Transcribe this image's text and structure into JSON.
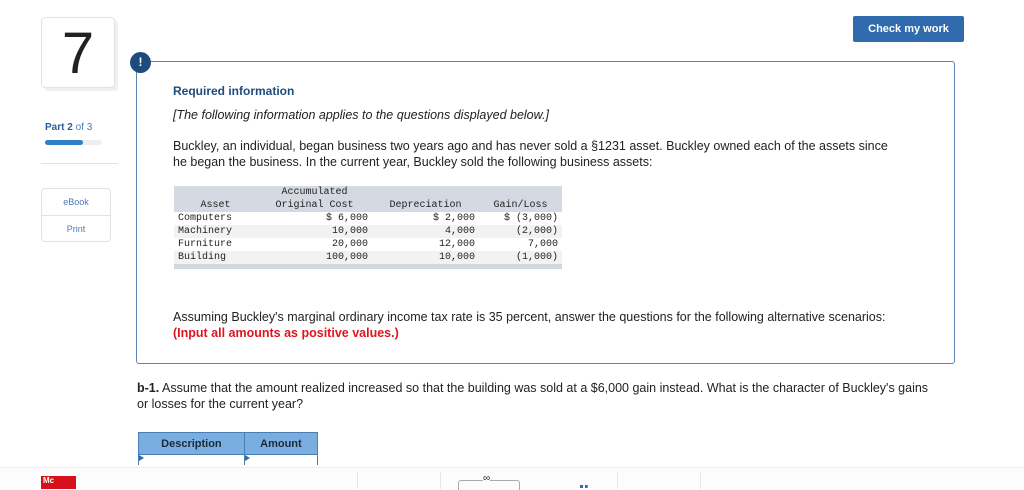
{
  "question_number": "7",
  "part": {
    "label": "Part",
    "current": "2",
    "of": "of 3",
    "progress": 0.67
  },
  "tools": {
    "ebook": "eBook",
    "print": "Print"
  },
  "check_button": "Check my work",
  "info": {
    "icon": "!",
    "title": "Required information",
    "intro": "[The following information applies to the questions displayed below.]",
    "paragraph": "Buckley, an individual, began business two years ago and has never sold a §1231 asset. Buckley owned each of the assets since he began the business. In the current year, Buckley sold the following business assets:",
    "table": {
      "headers": [
        "Asset",
        "Original Cost",
        "Accumulated",
        "Depreciation",
        "Gain/Loss"
      ],
      "rows": [
        [
          "Computers",
          "$  6,000",
          "$ 2,000",
          "$ (3,000)"
        ],
        [
          "Machinery",
          "10,000",
          "4,000",
          "(2,000)"
        ],
        [
          "Furniture",
          "20,000",
          "12,000",
          "7,000"
        ],
        [
          "Building",
          "100,000",
          "10,000",
          "(1,000)"
        ]
      ]
    },
    "paragraph2": "Assuming Buckley's marginal ordinary income tax rate is 35 percent, answer the questions for the following alternative scenarios:",
    "paragraph2_red": "(Input all amounts as positive values.)"
  },
  "question": {
    "label": "b-1.",
    "text": "Assume that the amount realized increased so that the building was sold at a $6,000 gain instead. What is the character of Buckley's gains or losses for the current year?"
  },
  "answer_table": {
    "headers": [
      "Description",
      "Amount"
    ]
  },
  "footer": {
    "logo": "Mc"
  }
}
